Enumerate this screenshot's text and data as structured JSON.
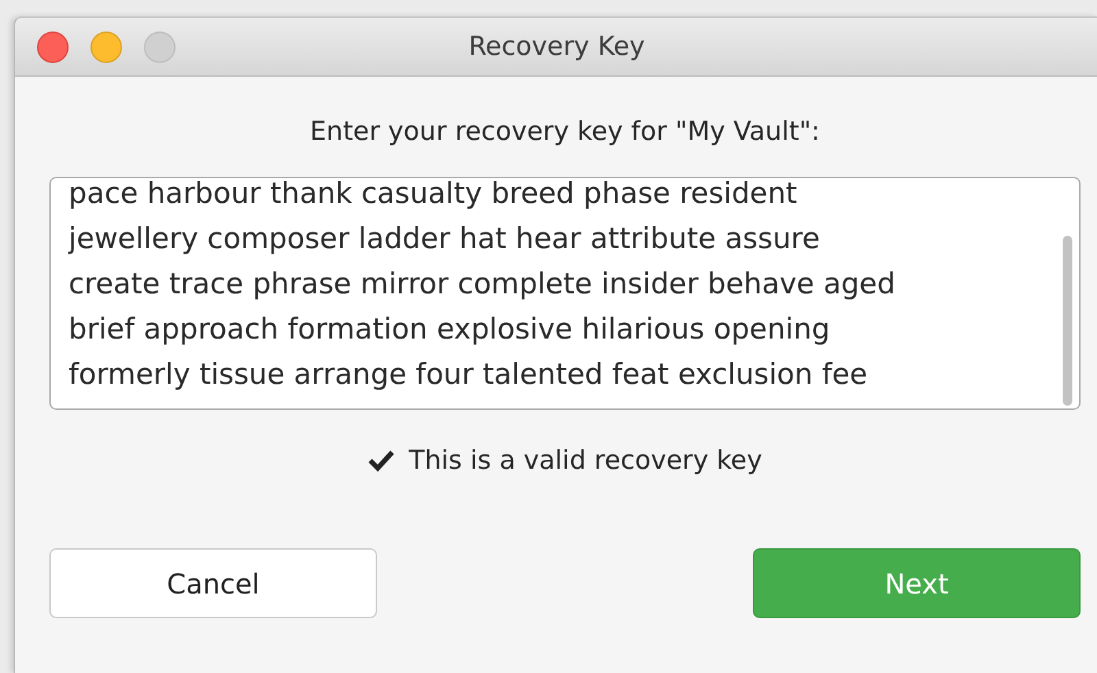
{
  "window": {
    "title": "Recovery Key",
    "zoom_disabled": true
  },
  "prompt": "Enter your recovery key for \"My Vault\":",
  "key_field": {
    "lines": [
      "pace harbour thank casualty breed phase resident",
      "jewellery composer ladder hat hear attribute assure",
      "create trace phrase mirror complete insider behave aged",
      "brief approach formation explosive hilarious opening",
      "formerly tissue arrange four talented feat exclusion fee"
    ]
  },
  "validation": {
    "valid": true,
    "message": "This is a valid recovery key"
  },
  "buttons": [
    {
      "label": "Cancel",
      "kind": "secondary"
    },
    {
      "label": "Next",
      "kind": "primary"
    }
  ]
}
